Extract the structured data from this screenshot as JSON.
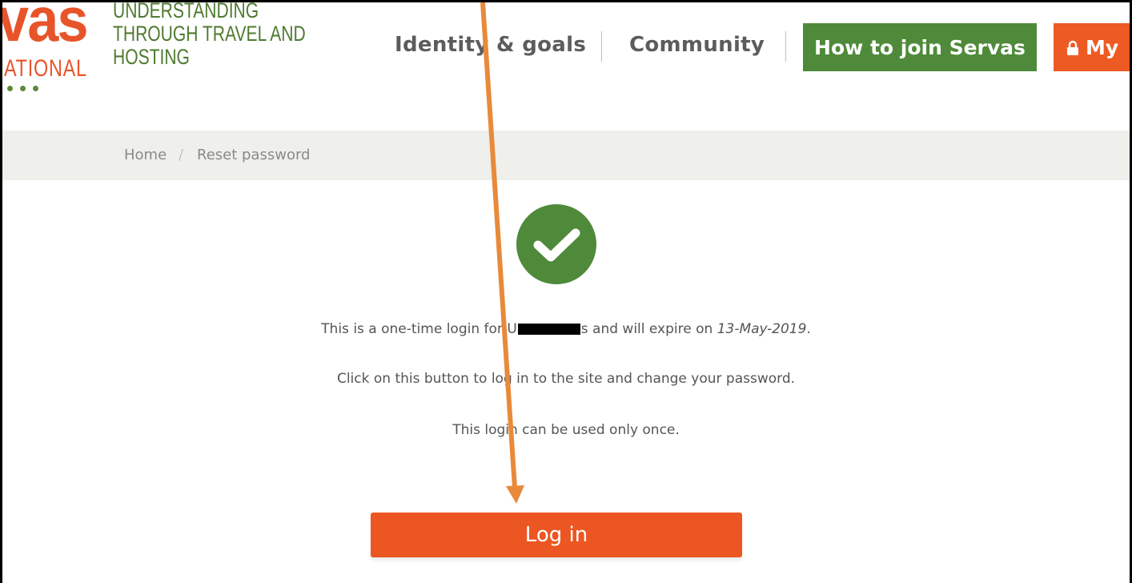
{
  "logo": {
    "big_text": "vas",
    "small_text": "ATIONAL",
    "tagline": [
      "UNDERSTANDING",
      "THROUGH TRAVEL AND",
      "HOSTING"
    ]
  },
  "nav": {
    "items": [
      {
        "label": "Identity & goals"
      },
      {
        "label": "Community"
      }
    ],
    "join_button": "How to join Servas",
    "my_button": "My"
  },
  "breadcrumb": {
    "home": "Home",
    "separator": "/",
    "current": "Reset password"
  },
  "message": {
    "line1_before": "This is a one-time login for",
    "line1_username_visible": "U",
    "line1_username_tail": "s",
    "line1_middle": "and will expire on",
    "line1_date": "13-May-2019",
    "line1_end": ".",
    "line2": "Click on this button to log in to the site and change your password.",
    "line3": "This login can be used only once."
  },
  "login_button": "Log in",
  "colors": {
    "brand_orange": "#e8542a",
    "brand_green": "#4f8a3a",
    "annotation_arrow": "#e88a3a"
  },
  "icons": {
    "check": "check-circle-icon",
    "lock": "lock-icon"
  }
}
